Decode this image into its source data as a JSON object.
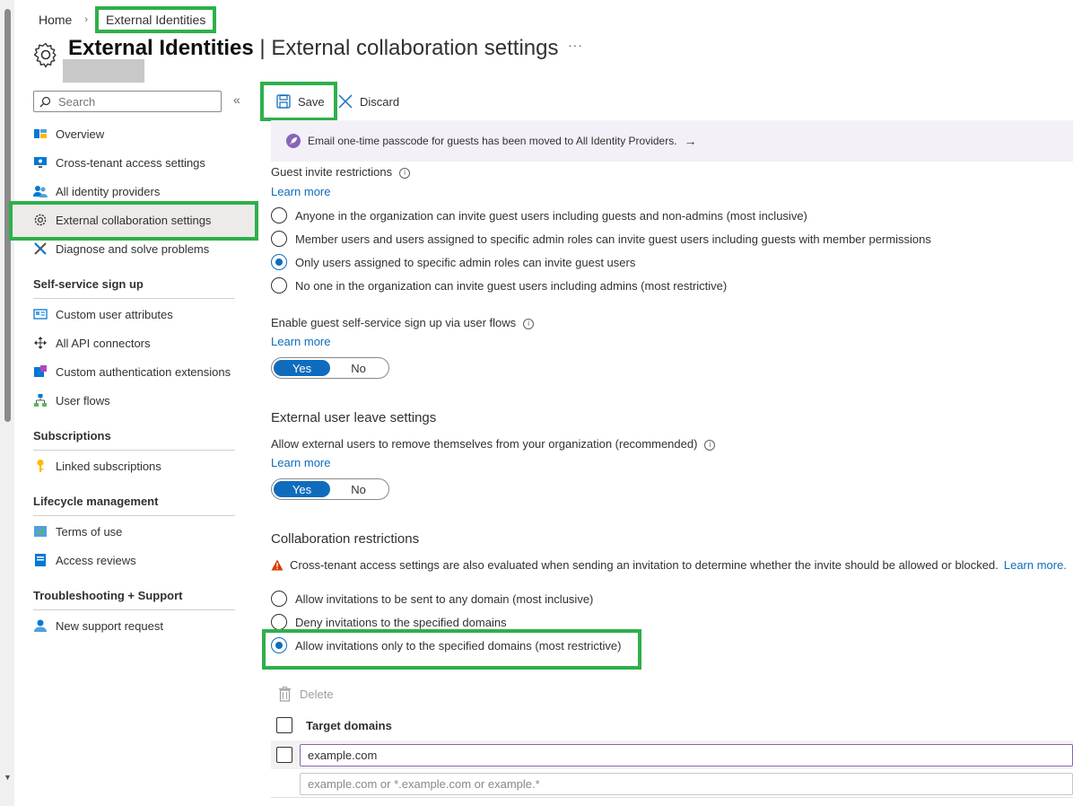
{
  "breadcrumb": {
    "home": "Home",
    "current": "External Identities"
  },
  "header": {
    "title_main": "External Identities",
    "separator": " | ",
    "title_sub": "External collaboration settings",
    "more": "···"
  },
  "sidebar": {
    "search_placeholder": "Search",
    "collapse": "«",
    "items": [
      {
        "label": "Overview",
        "icon": "overview-icon"
      },
      {
        "label": "Cross-tenant access settings",
        "icon": "monitor-icon"
      },
      {
        "label": "All identity providers",
        "icon": "users-icon"
      },
      {
        "label": "External collaboration settings",
        "icon": "gear-icon"
      },
      {
        "label": "Diagnose and solve problems",
        "icon": "wrench-icon"
      }
    ],
    "sections": [
      {
        "title": "Self-service sign up",
        "items": [
          {
            "label": "Custom user attributes",
            "icon": "attributes-icon"
          },
          {
            "label": "All API connectors",
            "icon": "connector-icon"
          },
          {
            "label": "Custom authentication extensions",
            "icon": "extension-icon"
          },
          {
            "label": "User flows",
            "icon": "flow-icon"
          }
        ]
      },
      {
        "title": "Subscriptions",
        "items": [
          {
            "label": "Linked subscriptions",
            "icon": "key-icon"
          }
        ]
      },
      {
        "title": "Lifecycle management",
        "items": [
          {
            "label": "Terms of use",
            "icon": "checklist-icon"
          },
          {
            "label": "Access reviews",
            "icon": "review-icon"
          }
        ]
      },
      {
        "title": "Troubleshooting + Support",
        "items": [
          {
            "label": "New support request",
            "icon": "support-icon"
          }
        ]
      }
    ]
  },
  "toolbar": {
    "save": "Save",
    "discard": "Discard"
  },
  "banner": {
    "text": "Email one-time passcode for guests has been moved to All Identity Providers.",
    "arrow": "→"
  },
  "guest_invite": {
    "label": "Guest invite restrictions",
    "learn_more": "Learn more",
    "options": [
      "Anyone in the organization can invite guest users including guests and non-admins (most inclusive)",
      "Member users and users assigned to specific admin roles can invite guest users including guests with member permissions",
      "Only users assigned to specific admin roles can invite guest users",
      "No one in the organization can invite guest users including admins (most restrictive)"
    ],
    "selected_index": 2
  },
  "self_service": {
    "label": "Enable guest self-service sign up via user flows",
    "learn_more": "Learn more",
    "yes": "Yes",
    "no": "No",
    "value": "Yes"
  },
  "leave": {
    "heading": "External user leave settings",
    "label": "Allow external users to remove themselves from your organization (recommended)",
    "learn_more": "Learn more",
    "yes": "Yes",
    "no": "No",
    "value": "Yes"
  },
  "collab": {
    "heading": "Collaboration restrictions",
    "warning": "Cross-tenant access settings are also evaluated when sending an invitation to determine whether the invite should be allowed or blocked.",
    "warning_link": "Learn more.",
    "options": [
      "Allow invitations to be sent to any domain (most inclusive)",
      "Deny invitations to the specified domains",
      "Allow invitations only to the specified domains (most restrictive)"
    ],
    "selected_index": 2,
    "delete": "Delete",
    "column_header": "Target domains",
    "domain_value": "example.com",
    "domain_placeholder": "example.com or *.example.com or example.*"
  },
  "colors": {
    "accent": "#0f6cbd",
    "highlight": "#2eb04b",
    "banner_bg": "#f4f0f8",
    "warning": "#d83b01"
  }
}
